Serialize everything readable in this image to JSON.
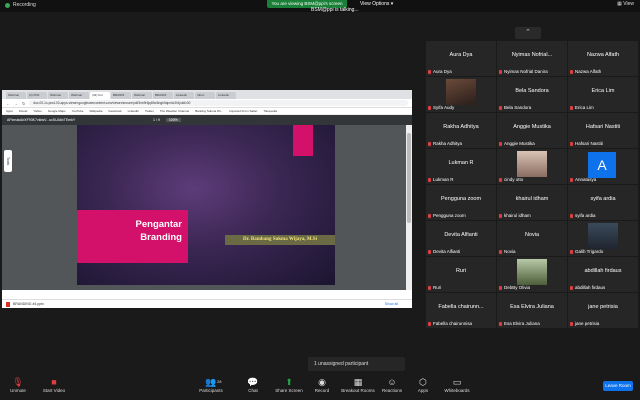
{
  "topbar": {
    "recording": "Recording",
    "viewing": "You are viewing BSM@ppi's screen",
    "view_options": "View Options",
    "view": "View",
    "talking": "BSM@ppi is talking..."
  },
  "share": {
    "tabs": [
      "Webinar",
      "(2) PDF",
      "Webinar",
      "Webinar",
      "(42) Kul",
      "BRANDI",
      "Webinar",
      "BRANDI",
      "Linkedin",
      "Inbox",
      "Linkedin"
    ],
    "url": "doc-00-1c-prod-03-apps-viewer.googleusercontent.com/viewer/secure/pdf/3nb9r6jq69oi6ngb5ajm4c3h1jsk6v30",
    "bookmarks": [
      "Apps",
      "iCloud",
      "Yahoo",
      "Google Maps",
      "YouTube",
      "Wikipedia",
      "Facebook",
      "LinkedIn",
      "Twitter",
      "The Weather Channel",
      "Banking Sukma Wi...",
      "Imported From Safari",
      "Tokopedia"
    ],
    "file_name": "APzmakAbXF93K7vkbsV...ucSUA6xTEmkY",
    "page": "1 / 9",
    "zoom": "100%",
    "tools_label": "Tools",
    "slide_title_line1": "Pengantar",
    "slide_title_line2": "Branding",
    "slide_author": "Dr. Bambang Sukma Wijaya, M.Si",
    "download_file": "BRANDING #4.pptx",
    "show_all": "Show all"
  },
  "participants": [
    {
      "big": "Aura Dya",
      "label": "Aura Dya"
    },
    {
      "big": "Nyimas Nofrial...",
      "label": "Nyimas Nofrial Danira"
    },
    {
      "big": "Nazwa Alfath",
      "label": "Nazwa Alfath"
    },
    {
      "big": "",
      "label": "Syifa Audy",
      "photo": "dark"
    },
    {
      "big": "Bela Sandora",
      "label": "Bela Sandora"
    },
    {
      "big": "Erica Lim",
      "label": "Erica Lim"
    },
    {
      "big": "Rakha Adhitya",
      "label": "Rakha Adhitya"
    },
    {
      "big": "Anggie Mustika",
      "label": "Anggie Mustika"
    },
    {
      "big": "Hafsari Nastiti",
      "label": "Hafsari Nastiti"
    },
    {
      "big": "Lukman R",
      "label": "Lukman R"
    },
    {
      "big": "",
      "label": "cindy otto",
      "photo": "light"
    },
    {
      "big": "",
      "label": "Annatasya",
      "avatar": "A"
    },
    {
      "big": "Pengguna zoom",
      "label": "Pengguna zoom"
    },
    {
      "big": "khairul idham",
      "label": "khairul idham"
    },
    {
      "big": "syifa ardia",
      "label": "syifa ardia"
    },
    {
      "big": "Devita Alfianti",
      "label": "Devita Alfianti"
    },
    {
      "big": "Novia",
      "label": "Novia"
    },
    {
      "big": "",
      "label": "Galih Trigardo",
      "photo": "person"
    },
    {
      "big": "Ruri",
      "label": "Ruri"
    },
    {
      "big": "",
      "label": "DebBy Olivia",
      "photo": "outdoor"
    },
    {
      "big": "abdillah firdaus",
      "label": "abdillah firdaus"
    },
    {
      "big": "Fabella chairunn...",
      "label": "Fabella chairunnisa"
    },
    {
      "big": "Esa Elvira Juliana",
      "label": "Esa Elvira Juliana"
    },
    {
      "big": "jane petrisia",
      "label": "jane petrisia"
    }
  ],
  "unassigned": "1 unassigned participant",
  "toolbar": {
    "unmute": "Unmute",
    "start_video": "Start Video",
    "participants": "Participants",
    "participants_count": "28",
    "chat": "Chat",
    "share_screen": "Share Screen",
    "record": "Record",
    "breakout": "Breakout Rooms",
    "reactions": "Reactions",
    "apps": "Apps",
    "whiteboards": "Whiteboards",
    "leave": "Leave Room"
  },
  "colors": {
    "accent": "#0e72ed",
    "share_green": "#23a248",
    "slide_pink": "#d4116a"
  }
}
